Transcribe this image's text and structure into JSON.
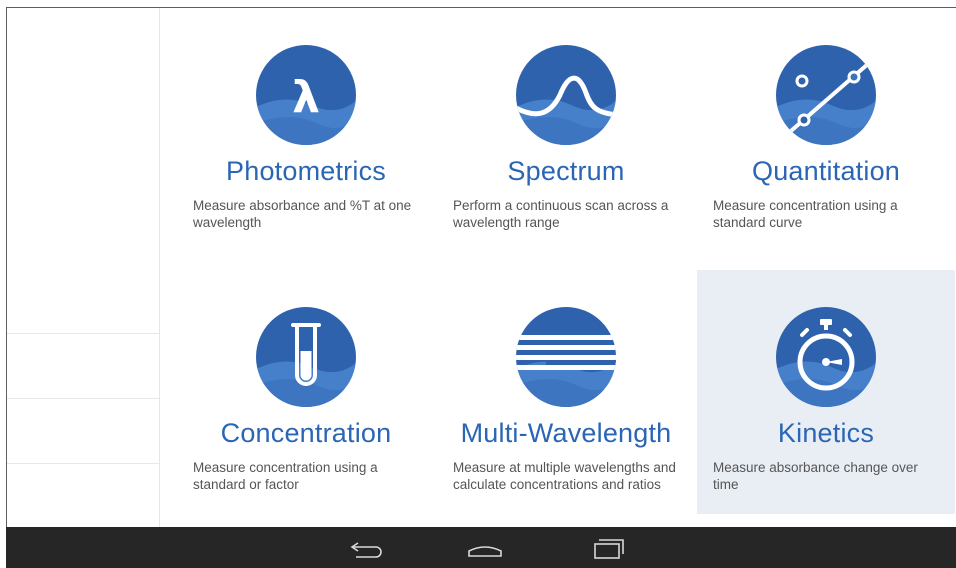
{
  "tiles": [
    {
      "title": "Photometrics",
      "desc": "Measure absorbance and %T at one wavelength",
      "icon": "lambda-icon"
    },
    {
      "title": "Spectrum",
      "desc": "Perform a continuous scan across a wavelength range",
      "icon": "spectrum-curve-icon"
    },
    {
      "title": "Quantitation",
      "desc": "Measure concentration using a standard curve",
      "icon": "standard-curve-icon"
    },
    {
      "title": "Concentration",
      "desc": "Measure concentration using a standard or factor",
      "icon": "test-tube-icon"
    },
    {
      "title": "Multi-Wavelength",
      "desc": "Measure at multiple wavelengths and calculate concentrations and ratios",
      "icon": "multi-wavelength-icon"
    },
    {
      "title": "Kinetics",
      "desc": "Measure absorbance change over time",
      "icon": "stopwatch-icon",
      "selected": true
    }
  ],
  "colors": {
    "accent": "#2b66b5",
    "icon_dark": "#2f62ad",
    "icon_light": "#4b86cf",
    "selected_bg": "#e9eef5",
    "navbar": "#262626"
  },
  "navbar": {
    "back": "back-icon",
    "home": "home-icon",
    "recents": "recent-apps-icon"
  }
}
